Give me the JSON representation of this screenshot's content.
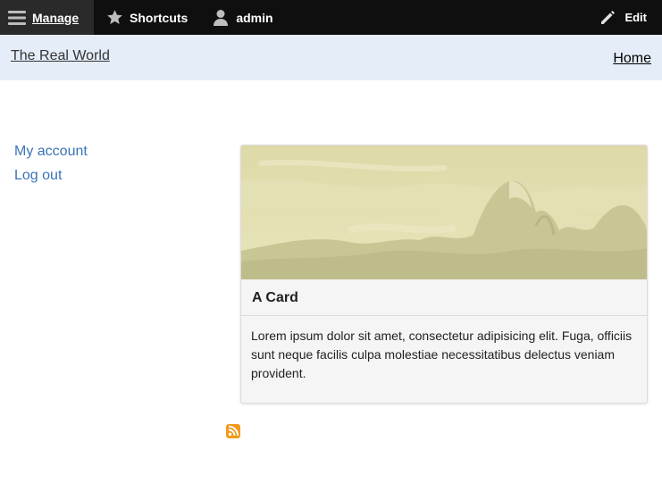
{
  "toolbar": {
    "manage_label": "Manage",
    "manage_icon": "hamburger-menu-icon",
    "shortcuts_label": "Shortcuts",
    "shortcuts_icon": "star-icon",
    "user_label": "admin",
    "user_icon": "user-icon",
    "edit_label": "Edit",
    "edit_icon": "pencil-icon",
    "background": "#0f0f0f"
  },
  "header": {
    "site_name": "The Real World",
    "home_link": "Home",
    "background": "#e5edf8"
  },
  "sidebar": {
    "items": [
      {
        "label": "My account"
      },
      {
        "label": "Log out"
      }
    ],
    "link_color": "#3b73b9"
  },
  "card": {
    "title": "A Card",
    "body": "Lorem ipsum dolor sit amet, consectetur adipisicing elit. Fuga, officiis sunt neque facilis culpa molestiae necessitatibus delectus veniam provident.",
    "image_icon": "landscape-painting-image"
  },
  "feed": {
    "icon": "rss-feed-icon",
    "color": "#f39a1d"
  }
}
